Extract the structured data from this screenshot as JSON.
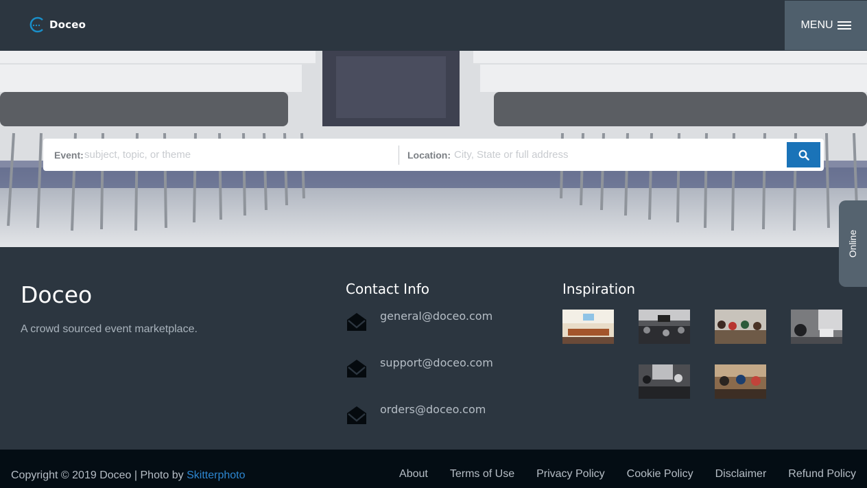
{
  "header": {
    "logo_text": "Doceo",
    "menu_label": "MENU"
  },
  "search": {
    "event_label": "Event:",
    "event_placeholder": "subject, topic, or theme",
    "location_label": "Location:",
    "location_placeholder": "City, State or full address",
    "button_icon": "search-icon"
  },
  "online_tab": "Online",
  "footer": {
    "brand_title": "Doceo",
    "tagline": "A crowd sourced event marketplace.",
    "contact_title": "Contact Info",
    "contacts": [
      "general@doceo.com",
      "support@doceo.com",
      "orders@doceo.com"
    ],
    "inspiration_title": "Inspiration"
  },
  "bottom": {
    "copyright_prefix": "Copyright © 2019 Doceo | Photo by ",
    "photo_credit": "Skitterphoto",
    "links": [
      "About",
      "Terms of Use",
      "Privacy Policy",
      "Cookie Policy",
      "Disclaimer",
      "Refund Policy"
    ]
  },
  "colors": {
    "header_bg": "#2c3640",
    "menu_bg": "#4f5f6c",
    "accent": "#1a73b8",
    "bottom_bg": "#040d14"
  }
}
